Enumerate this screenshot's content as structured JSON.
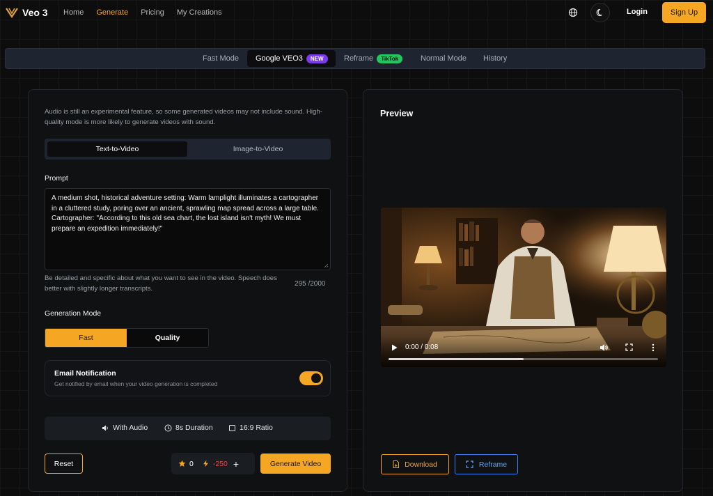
{
  "app": {
    "name": "Veo 3"
  },
  "nav": {
    "links": [
      "Home",
      "Generate",
      "Pricing",
      "My Creations"
    ],
    "login": "Login",
    "signup": "Sign Up"
  },
  "modes": {
    "tabs": [
      "Fast Mode",
      "Google VEO3",
      "Reframe",
      "Normal Mode",
      "History"
    ],
    "active": "Google VEO3",
    "new_badge": "NEW",
    "tiktok_badge": "TikTok"
  },
  "form": {
    "notice": "Audio is still an experimental feature, so some generated videos may not include sound. High-quality mode is more likely to generate videos with sound.",
    "input_tabs": [
      "Text-to-Video",
      "Image-to-Video"
    ],
    "prompt_label": "Prompt",
    "prompt_value": "A medium shot, historical adventure setting: Warm lamplight illuminates a cartographer in a cluttered study, poring over an ancient, sprawling map spread across a large table. Cartographer: \"According to this old sea chart, the lost island isn't myth! We must prepare an expedition immediately!\"",
    "prompt_hint": "Be detailed and specific about what you want to see in the video. Speech does better with slightly longer transcripts.",
    "char_count": "295 /2000",
    "generation_mode_label": "Generation Mode",
    "generation_modes": [
      "Fast",
      "Quality"
    ],
    "email_title": "Email Notification",
    "email_subtitle": "Get notified by email when your video generation is completed",
    "email_enabled": true,
    "features": [
      "With Audio",
      "8s Duration",
      "16:9 Ratio"
    ],
    "reset": "Reset",
    "credits_stars": "0",
    "credits_cost": "-250",
    "plus": "+",
    "generate": "Generate Video"
  },
  "preview": {
    "title": "Preview",
    "time": "0:00 / 0:08",
    "progress": 0.5,
    "download": "Download",
    "reframe": "Reframe"
  },
  "colors": {
    "accent": "#f5a623",
    "new_badge": "#7c3aed",
    "tiktok_badge": "#22c55e",
    "reframe": "#3b82f6"
  }
}
